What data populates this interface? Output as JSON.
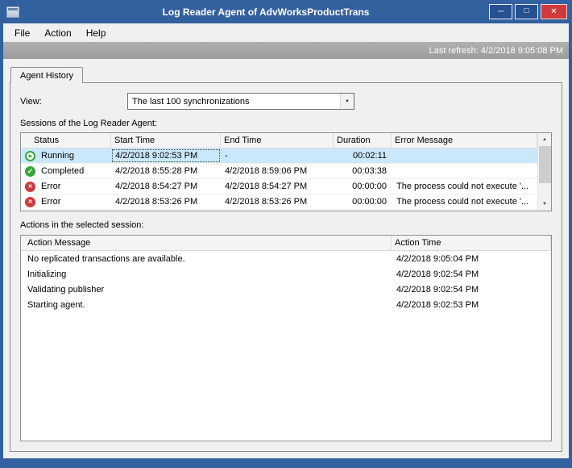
{
  "window": {
    "title": "Log Reader Agent of AdvWorksProductTrans",
    "menu": [
      "File",
      "Action",
      "Help"
    ],
    "last_refresh": "Last refresh: 4/2/2018 9:05:08 PM",
    "tab_label": "Agent History"
  },
  "icons": {
    "minimize": "─",
    "maximize": "□",
    "close": "✕",
    "dropdown": "▼",
    "scroll_up": "▲",
    "scroll_down": "▼",
    "running": "▶",
    "completed": "✓",
    "error": "✕"
  },
  "view": {
    "label": "View:",
    "value": "The last 100 synchronizations"
  },
  "sessions": {
    "label": "Sessions of the Log Reader Agent:",
    "columns": [
      "Status",
      "Start Time",
      "End Time",
      "Duration",
      "Error Message"
    ],
    "rows": [
      {
        "icon": "running",
        "status": "Running",
        "start": "4/2/2018 9:02:53 PM",
        "end": "-",
        "duration": "00:02:11",
        "error": "",
        "selected": true
      },
      {
        "icon": "completed",
        "status": "Completed",
        "start": "4/2/2018 8:55:28 PM",
        "end": "4/2/2018 8:59:06 PM",
        "duration": "00:03:38",
        "error": "",
        "selected": false
      },
      {
        "icon": "error",
        "status": "Error",
        "start": "4/2/2018 8:54:27 PM",
        "end": "4/2/2018 8:54:27 PM",
        "duration": "00:00:00",
        "error": "The process could not execute '...",
        "selected": false
      },
      {
        "icon": "error",
        "status": "Error",
        "start": "4/2/2018 8:53:26 PM",
        "end": "4/2/2018 8:53:26 PM",
        "duration": "00:00:00",
        "error": "The process could not execute '...",
        "selected": false
      }
    ]
  },
  "actions": {
    "label": "Actions in the selected session:",
    "columns": [
      "Action Message",
      "Action Time"
    ],
    "rows": [
      {
        "message": "No replicated transactions are available.",
        "time": "4/2/2018 9:05:04 PM"
      },
      {
        "message": "Initializing",
        "time": "4/2/2018 9:02:54 PM"
      },
      {
        "message": "Validating publisher",
        "time": "4/2/2018 9:02:54 PM"
      },
      {
        "message": "Starting agent.",
        "time": "4/2/2018 9:02:53 PM"
      }
    ]
  },
  "colors": {
    "chrome_blue": "#33609f",
    "close_red": "#d03a3a",
    "selection_blue": "#cbe8fa",
    "status_green": "#39a43c",
    "status_error_red": "#cf3a3a",
    "strip_gray": "#a5a5a5"
  }
}
